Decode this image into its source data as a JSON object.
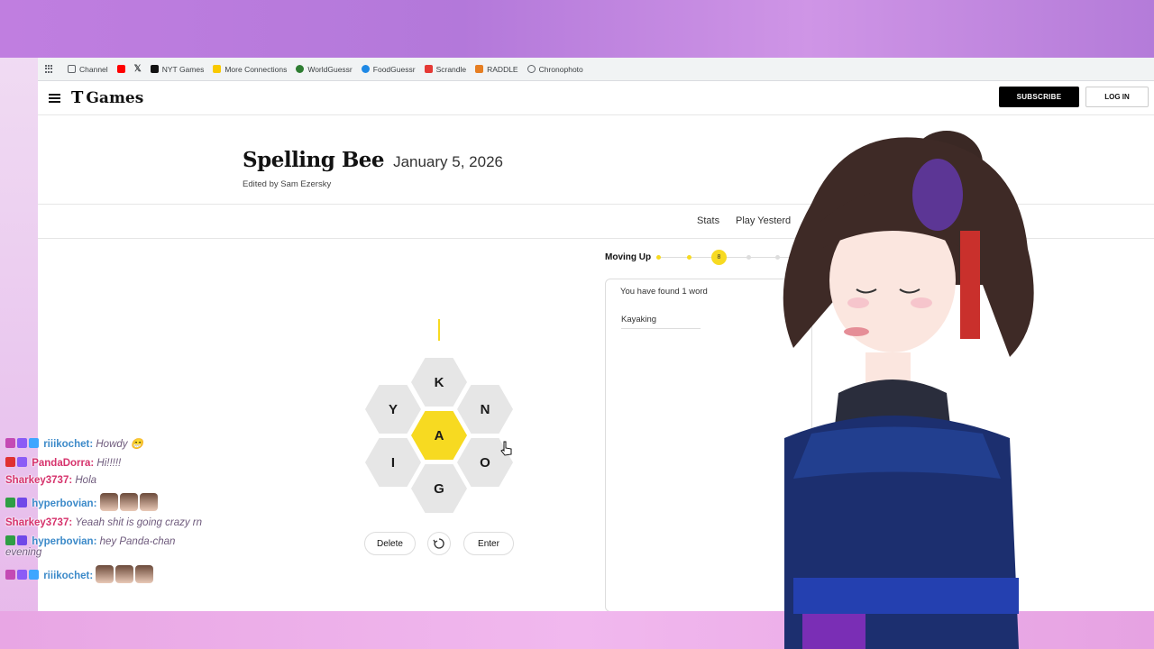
{
  "bookmarks": [
    {
      "label": "",
      "icon": "apps-grid-icon"
    },
    {
      "label": "Channel",
      "icon": "folder-icon",
      "color": "#5f6368"
    },
    {
      "label": "",
      "icon": "youtube-icon",
      "color": "#ff0000"
    },
    {
      "label": "",
      "icon": "x-logo-icon",
      "color": "#000000"
    },
    {
      "label": "NYT Games",
      "icon": "nyt-icon",
      "color": "#121212"
    },
    {
      "label": "More Connections",
      "icon": "connections-icon",
      "color": "#f9c900"
    },
    {
      "label": "WorldGuessr",
      "icon": "globe-icon",
      "color": "#2e7d32"
    },
    {
      "label": "FoodGuessr",
      "icon": "food-icon",
      "color": "#1e88e5"
    },
    {
      "label": "Scrandle",
      "icon": "scrandle-icon",
      "color": "#e53935"
    },
    {
      "label": "RADDLE",
      "icon": "raddle-icon",
      "color": "#e67e22"
    },
    {
      "label": "Chronophoto",
      "icon": "camera-icon",
      "color": "#5f6368"
    }
  ],
  "header": {
    "logo_t": "T",
    "logo_games": "Games",
    "subscribe": "SUBSCRIBE",
    "login": "LOG IN"
  },
  "puzzle": {
    "title": "Spelling Bee",
    "date": "January 5, 2026",
    "editor": "Edited by Sam Ezersky"
  },
  "nav": {
    "stats": "Stats",
    "yesterday": "Play Yesterd"
  },
  "progress": {
    "rank": "Moving Up",
    "score": "8",
    "accent": "#f7da21"
  },
  "found": {
    "count_text": "You have found 1 word",
    "words": [
      "Kayaking"
    ]
  },
  "hive": {
    "center": "A",
    "outer": [
      "K",
      "Y",
      "N",
      "I",
      "O",
      "G"
    ]
  },
  "controls": {
    "delete": "Delete",
    "shuffle": "shuffle-icon",
    "enter": "Enter"
  },
  "chat": [
    {
      "user": "riiikochet",
      "color": "#3c8ac9",
      "message": "Howdy 😁"
    },
    {
      "user": "PandaDorra",
      "color": "#d6336c",
      "message": "Hi!!!!!"
    },
    {
      "user": "Sharkey3737",
      "color": "#d6336c",
      "message": "Hola"
    },
    {
      "user": "hyperbovian",
      "color": "#3c8ac9",
      "message": ""
    },
    {
      "user": "Sharkey3737",
      "color": "#d6336c",
      "message": "Yeaah shit is going crazy rn"
    },
    {
      "user": "hyperbovian",
      "color": "#3c8ac9",
      "message": "hey Panda-chan evening"
    },
    {
      "user": "riiikochet",
      "color": "#3c8ac9",
      "message": ""
    }
  ]
}
